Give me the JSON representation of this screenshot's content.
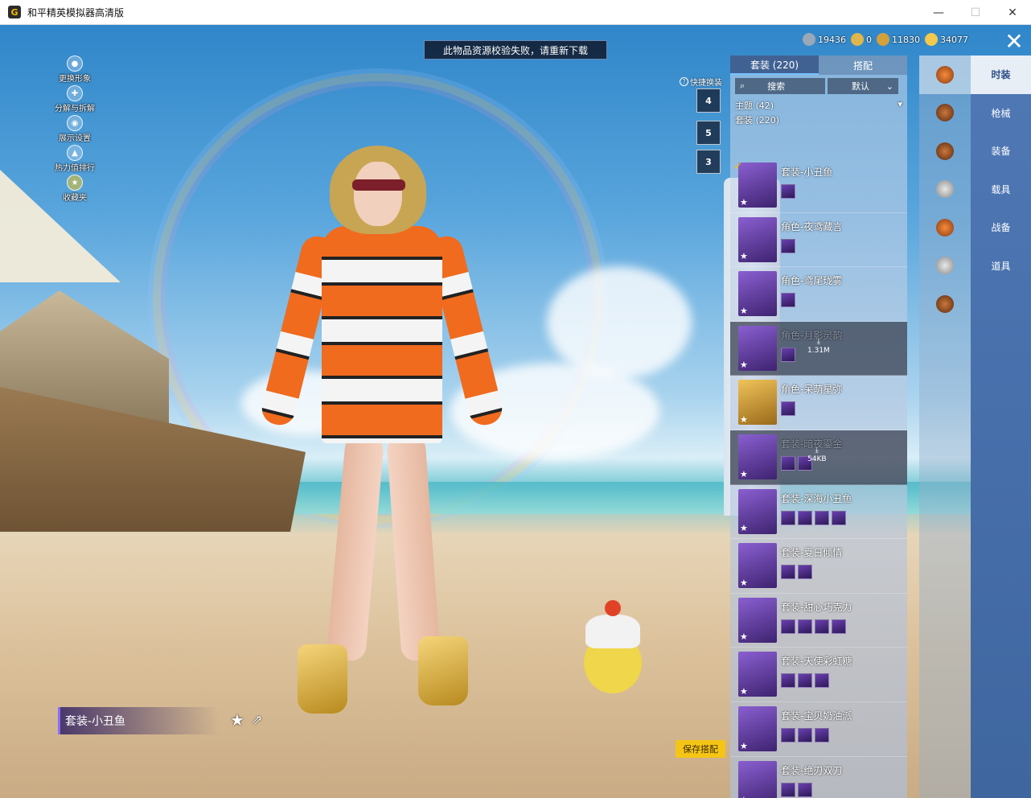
{
  "window": {
    "title": "和平精英模拟器高清版",
    "app_icon": "G"
  },
  "notice": "此物品资源校验失败，请重新下载",
  "left_menu": [
    {
      "label": "更换形象",
      "icon": "avatar-icon"
    },
    {
      "label": "分解与拆解",
      "icon": "gear-icon"
    },
    {
      "label": "展示设置",
      "icon": "eye-icon"
    },
    {
      "label": "热力值排行",
      "icon": "flame-icon"
    },
    {
      "label": "收藏夹",
      "icon": "star-icon"
    }
  ],
  "quick_change": {
    "label": "快捷换装",
    "slots": [
      "4",
      "5",
      "3"
    ]
  },
  "currencies": [
    {
      "value": "19436",
      "color": "#9aa7b8"
    },
    {
      "value": "0",
      "color": "#e0b54a"
    },
    {
      "value": "11830",
      "color": "#d4a03a"
    },
    {
      "value": "34077",
      "color": "#f2c94c"
    }
  ],
  "panel": {
    "tabs": [
      "套装 (220)",
      "搭配"
    ],
    "search_label": "搜索",
    "sort_label": "默认",
    "theme_label": "主题 (42)",
    "count_label": "套装 (220)"
  },
  "outfits": [
    {
      "name": "套装-小丑鱼",
      "selected": true,
      "downloadable": false,
      "parts": 1,
      "gold": false
    },
    {
      "name": "角色-夜鸢藏言",
      "selected": false,
      "downloadable": false,
      "parts": 1,
      "gold": false
    },
    {
      "name": "角色-鸢尾珑雾",
      "selected": false,
      "downloadable": false,
      "parts": 1,
      "gold": false
    },
    {
      "name": "角色-月影灵韵",
      "selected": false,
      "downloadable": true,
      "size": "1.31M",
      "parts": 1,
      "gold": false
    },
    {
      "name": "角色-呆萌星弥",
      "selected": false,
      "downloadable": false,
      "parts": 1,
      "gold": true
    },
    {
      "name": "套装-暗夜鎏金",
      "selected": false,
      "downloadable": true,
      "size": "54KB",
      "parts": 2,
      "gold": false
    },
    {
      "name": "套装-深海小丑鱼",
      "selected": false,
      "downloadable": false,
      "parts": 4,
      "gold": false
    },
    {
      "name": "套装-夏日倾情",
      "selected": false,
      "downloadable": false,
      "parts": 2,
      "gold": false
    },
    {
      "name": "套装-甜心巧克力",
      "selected": false,
      "downloadable": false,
      "parts": 4,
      "gold": false
    },
    {
      "name": "套装-天使彩虹糖",
      "selected": false,
      "downloadable": false,
      "parts": 3,
      "gold": false
    },
    {
      "name": "套装-宝贝奶油派",
      "selected": false,
      "downloadable": false,
      "parts": 3,
      "gold": false
    },
    {
      "name": "套装-绝刃双刀",
      "selected": false,
      "downloadable": false,
      "parts": 2,
      "gold": false
    }
  ],
  "categories": [
    "outfit-icon",
    "gun-skin-icon",
    "helmet-icon",
    "mask-icon",
    "outfit-icon",
    "parachute-icon",
    "vehicle-icon"
  ],
  "right_nav": [
    "时装",
    "枪械",
    "装备",
    "载具",
    "战备",
    "道具"
  ],
  "current_outfit": "套装-小丑鱼",
  "save_button": "保存搭配",
  "colors": {
    "accent": "#f5c516",
    "nav_bg": "#4f78b5",
    "purple_rarity": "#8a5fd1"
  }
}
